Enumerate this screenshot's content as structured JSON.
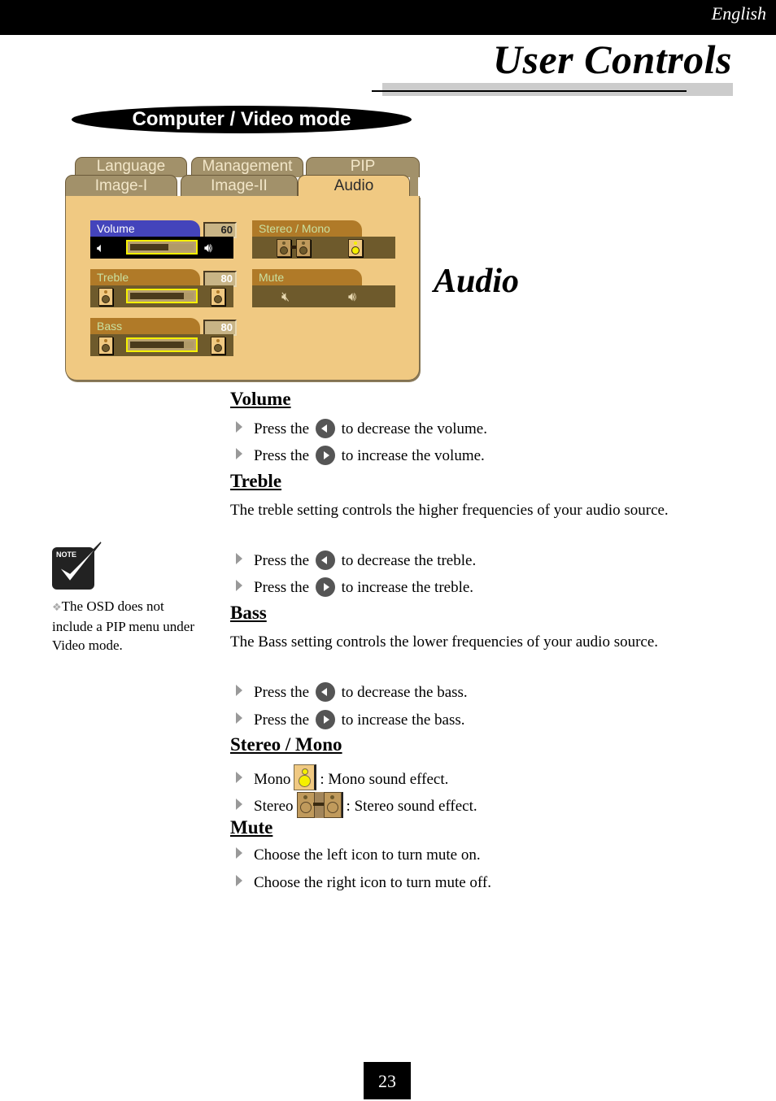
{
  "header": {
    "language": "English",
    "title": "User Controls"
  },
  "mode_label": "Computer / Video mode",
  "osd": {
    "tabs_back": [
      "Language",
      "Management",
      "PIP"
    ],
    "tabs_front": [
      "Image-I",
      "Image-II",
      "Audio"
    ],
    "active_tab": "Audio",
    "controls": {
      "volume": {
        "label": "Volume",
        "value": "60",
        "level_fraction": 0.6
      },
      "treble": {
        "label": "Treble",
        "value": "80",
        "level_fraction": 0.85
      },
      "bass": {
        "label": "Bass",
        "value": "80",
        "level_fraction": 0.85
      },
      "stereo_mono": {
        "label": "Stereo / Mono",
        "selected": "Mono"
      },
      "mute": {
        "label": "Mute"
      }
    },
    "colors": {
      "panel": "#f0c982",
      "selected_label": "#4444bb",
      "label": "#b07a28",
      "row": "#6e5a2c",
      "slider_border": "#f5f000"
    }
  },
  "section_title": "Audio",
  "sections": {
    "volume": {
      "heading": "Volume",
      "bullets": [
        {
          "pre": "Press the",
          "button": "left",
          "post": "to decrease the volume."
        },
        {
          "pre": "Press the",
          "button": "right",
          "post": "to increase the volume."
        }
      ]
    },
    "treble": {
      "heading": "Treble",
      "description": "The treble setting controls the higher frequencies of your audio source.",
      "bullets": [
        {
          "pre": "Press the",
          "button": "left",
          "post": "to decrease the treble."
        },
        {
          "pre": "Press the",
          "button": "right",
          "post": "to increase the treble."
        }
      ]
    },
    "bass": {
      "heading": "Bass",
      "description": "The Bass setting controls the lower frequencies of your audio source.",
      "bullets": [
        {
          "pre": "Press the",
          "button": "left",
          "post": "to decrease the bass."
        },
        {
          "pre": "Press the",
          "button": "right",
          "post": "to increase the bass."
        }
      ]
    },
    "stereo_mono": {
      "heading": "Stereo / Mono",
      "bullets": [
        {
          "pre": "Mono",
          "icon": "mono-speaker-icon",
          "post": ": Mono sound effect."
        },
        {
          "pre": "Stereo",
          "icon": "stereo-speakers-icon",
          "post": ": Stereo sound effect."
        }
      ]
    },
    "mute": {
      "heading": "Mute",
      "bullets": [
        {
          "text": "Choose the left icon to turn mute on."
        },
        {
          "text": "Choose the right icon to turn mute off."
        }
      ]
    }
  },
  "note": {
    "icon_label": "NOTE",
    "text": "The OSD does not include a PIP menu under Video mode."
  },
  "page_number": "23"
}
